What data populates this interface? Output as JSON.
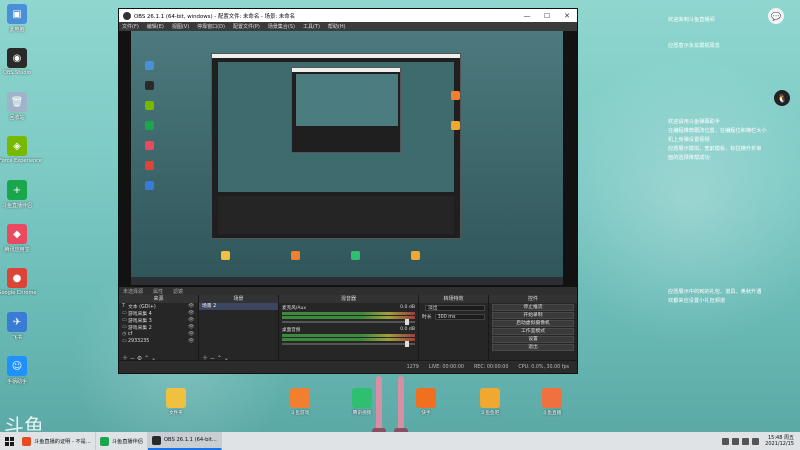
{
  "desktop": {
    "left_icons": [
      {
        "label": "此电脑",
        "color": "#4a90d9",
        "glyph": "▣",
        "icon": "computer-icon"
      },
      {
        "label": "OBS Studio",
        "color": "#2a2a2a",
        "glyph": "◉",
        "icon": "obs-icon"
      },
      {
        "label": "回收站",
        "color": "#9fb4c8",
        "glyph": "🗑",
        "icon": "recycle-bin-icon"
      },
      {
        "label": "GeForce Experience",
        "color": "#76b900",
        "glyph": "◈",
        "icon": "geforce-icon"
      },
      {
        "label": "斗鱼直播伴侣",
        "color": "#1aa64c",
        "glyph": "+",
        "icon": "live-companion-icon"
      },
      {
        "label": "腾讯应用宝",
        "color": "#e84a5f",
        "glyph": "◆",
        "icon": "app-store-icon"
      },
      {
        "label": "Google Chrome",
        "color": "#db4437",
        "glyph": "●",
        "icon": "chrome-icon"
      },
      {
        "label": "飞书",
        "color": "#3a7bd5",
        "glyph": "✈",
        "icon": "feishu-icon"
      },
      {
        "label": "手柄助手",
        "color": "#1e90ff",
        "glyph": "☺",
        "icon": "gamepad-helper-icon"
      }
    ],
    "bottom_icons": [
      {
        "label": "文件夹",
        "color": "#f0c040",
        "icon": "folder-icon"
      },
      {
        "label": "斗鱼游戏",
        "color": "#f08030",
        "icon": "douyu-game-icon"
      },
      {
        "label": "腾讯视频",
        "color": "#2fbf71",
        "icon": "video-player-icon"
      },
      {
        "label": "快手",
        "color": "#f07020",
        "icon": "kuaishou-icon"
      },
      {
        "label": "斗鱼鱼吧",
        "color": "#f0a830",
        "icon": "fish-icon"
      },
      {
        "label": "斗鱼直播",
        "color": "#f07040",
        "icon": "douyu-live-icon"
      }
    ],
    "watermark": "斗鱼",
    "watermark_small": "斗鱼"
  },
  "right_panel": {
    "line1": "欢迎来到斗鱼直播间",
    "line2": "应愿意示永友跟视周息",
    "tips": [
      "欢迎请用斗鱼弹幕助手",
      "在编程推荐跟改位置，在编程位和横栏大小",
      "机上身弹设置视频",
      "应愿展示模拟，宽前模板，标拉横升折审",
      "面的选择推帮成功"
    ],
    "bottom_tips": [
      "应愿展示中的到的礼包、道具、奥秋升遇",
      "欢都来应设置小礼包频道"
    ]
  },
  "obs": {
    "title": "OBS 26.1.1 (64-bit, windows) - 配置文件: 未命名 - 场景: 未命名",
    "menu": [
      "文件(F)",
      "编辑(E)",
      "视图(V)",
      "停靠窗口(D)",
      "配置文件(P)",
      "场景集合(S)",
      "工具(T)",
      "帮助(H)"
    ],
    "scene_bar": {
      "no_source": "未选择源",
      "props": "属性",
      "filters": "滤镜"
    },
    "docks": {
      "sources_title": "来源",
      "scenes_title": "场景",
      "mixer_title": "混音器",
      "transitions_title": "转场特效",
      "controls_title": "控件"
    },
    "sources": [
      {
        "type": "T",
        "name": "文本 (GDI+)"
      },
      {
        "type": "▭",
        "name": "游戏采集 4"
      },
      {
        "type": "▭",
        "name": "游戏采集 3"
      },
      {
        "type": "▭",
        "name": "游戏采集 2"
      },
      {
        "type": "◷",
        "name": "cf"
      },
      {
        "type": "▭",
        "name": "2933235"
      }
    ],
    "scenes": [
      "场景 2"
    ],
    "mixer": [
      {
        "name": "麦克风/Aux",
        "db": "0.0 dB"
      },
      {
        "name": "桌面音频",
        "db": "0.0 dB"
      }
    ],
    "transition": {
      "type": "淡出",
      "duration_label": "时长",
      "duration": "300 ms"
    },
    "controls": [
      "停止推流",
      "开始录制",
      "启动虚拟摄像机",
      "工作室模式",
      "设置",
      "退出"
    ],
    "status": {
      "live": "LIVE: 00:00:00",
      "rec": "REC: 00:00:00",
      "cpu": "CPU: 0.0%, 30.00 fps",
      "bitrate": "1279"
    }
  },
  "taskbar": {
    "items": [
      {
        "label": "斗鱼直播的证明 - 不是...",
        "color": "#e84a20",
        "icon": "douyu-taskbar-icon"
      },
      {
        "label": "斗鱼直播伴侣",
        "color": "#1aa64c",
        "icon": "live-companion-taskbar-icon"
      },
      {
        "label": "OBS 26.1.1 (64-bit...",
        "color": "#2a2a2a",
        "icon": "obs-taskbar-icon"
      }
    ],
    "time": "15:48 周五",
    "date": "2021/12/15"
  }
}
